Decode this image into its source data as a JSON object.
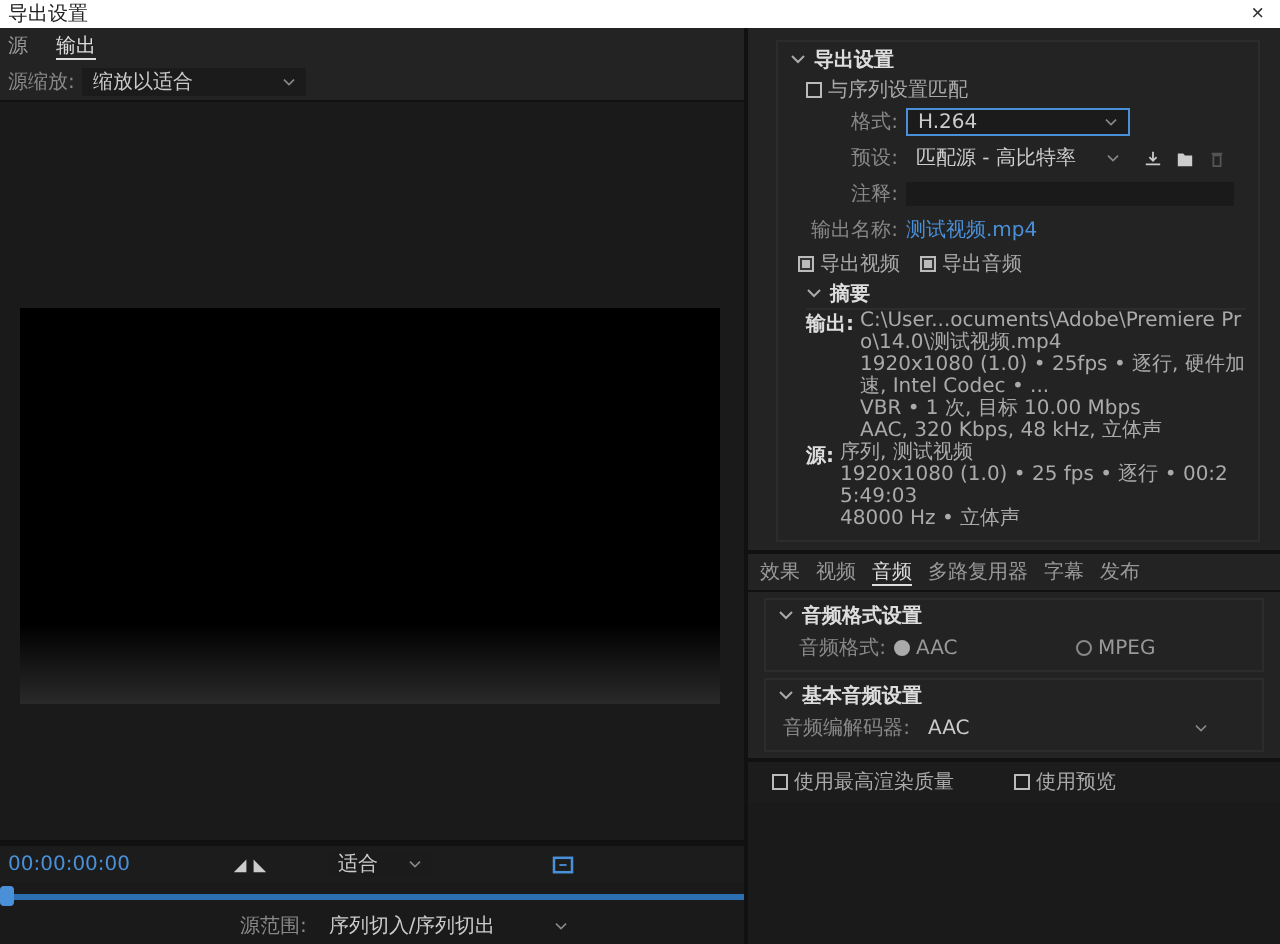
{
  "window": {
    "title": "导出设置",
    "close": "×"
  },
  "left_tabs": [
    {
      "label": "源",
      "selected": false
    },
    {
      "label": "输出",
      "selected": true
    }
  ],
  "source_scaling": {
    "label": "源缩放:",
    "value": "缩放以适合"
  },
  "playback": {
    "timecode": "00:00:00:00",
    "fit": "适合",
    "level": 0.0
  },
  "range": {
    "label": "源范围:",
    "value": "序列切入/序列切出"
  },
  "export_settings": {
    "title": "导出设置",
    "expanded": true,
    "match_sequence": {
      "label": "与序列设置匹配",
      "checked": false
    },
    "format": {
      "label": "格式:",
      "value": "H.264"
    },
    "preset": {
      "label": "预设:",
      "value": "匹配源 - 高比特率"
    },
    "comments": {
      "label": "注释:"
    },
    "output_name": {
      "label": "输出名称:",
      "value": "测试视频.mp4"
    },
    "export_video": {
      "label": "导出视频",
      "checked": true
    },
    "export_audio": {
      "label": "导出音频",
      "checked": true
    },
    "summary": {
      "title": "摘要",
      "expanded": true,
      "output_label": "输出:",
      "output_lines": [
        "C:\\User...ocuments\\Adobe\\Premiere Pro\\14.0\\测试视频.mp4",
        "1920x1080 (1.0) • 25fps • 逐行, 硬件加速, Intel Codec • ...",
        "VBR • 1 次, 目标 10.00 Mbps",
        "AAC, 320 Kbps, 48 kHz, 立体声"
      ],
      "source_label": "源:",
      "source_lines": [
        "序列, 测试视频",
        "1920x1080 (1.0) • 25 fps • 逐行 • 00:25:49:03",
        "48000 Hz • 立体声"
      ]
    }
  },
  "right_tabs": [
    {
      "label": "效果",
      "selected": false
    },
    {
      "label": "视频",
      "selected": false
    },
    {
      "label": "音频",
      "selected": true
    },
    {
      "label": "多路复用器",
      "selected": false
    },
    {
      "label": "字幕",
      "selected": false
    },
    {
      "label": "发布",
      "selected": false
    }
  ],
  "audio_format": {
    "title": "音频格式设置",
    "expanded": true,
    "label": "音频格式:",
    "options": [
      {
        "label": "AAC",
        "selected": true
      },
      {
        "label": "MPEG",
        "selected": false
      }
    ]
  },
  "basic_audio": {
    "title": "基本音频设置",
    "expanded": true,
    "codec_label": "音频编解码器:",
    "codec_value": "AAC"
  },
  "bottom_options": [
    {
      "label": "使用最高渲染质量",
      "checked": false
    },
    {
      "label": "使用预览",
      "checked": false
    }
  ]
}
